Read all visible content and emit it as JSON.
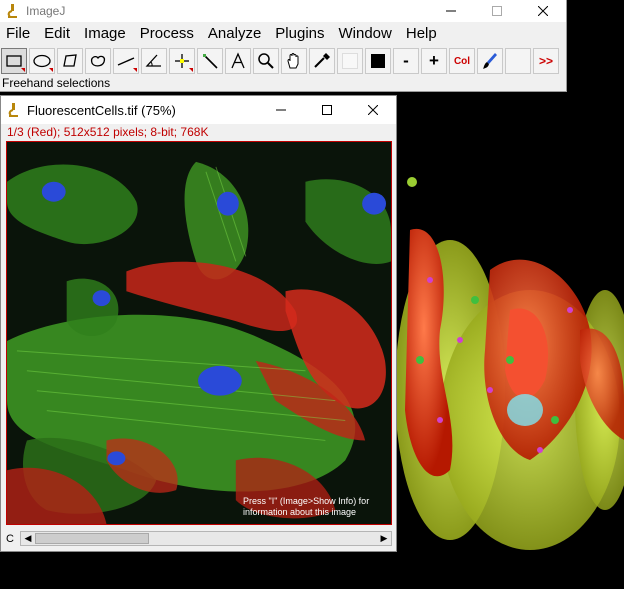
{
  "main_window": {
    "title": "ImageJ",
    "menu": [
      "File",
      "Edit",
      "Image",
      "Process",
      "Analyze",
      "Plugins",
      "Window",
      "Help"
    ],
    "toolbar": {
      "tools": [
        {
          "name": "rectangle-tool-icon",
          "active": true
        },
        {
          "name": "oval-tool-icon"
        },
        {
          "name": "polygon-tool-icon"
        },
        {
          "name": "freehand-tool-icon"
        },
        {
          "name": "line-tool-icon"
        },
        {
          "name": "angle-tool-icon"
        },
        {
          "name": "point-tool-icon"
        },
        {
          "name": "wand-tool-icon"
        },
        {
          "name": "text-tool-icon"
        },
        {
          "name": "magnifier-icon"
        },
        {
          "name": "hand-icon"
        },
        {
          "name": "color-picker-icon"
        }
      ],
      "minus_label": "-",
      "plus_label": "+",
      "col_label": "Col",
      "more_label": ">>"
    },
    "status": "Freehand selections"
  },
  "image_window": {
    "title": "FluorescentCells.tif (75%)",
    "info": "1/3 (Red); 512x512 pixels; 8-bit; 768K",
    "overlay_line1": "Press \"I\" (Image>Show Info) for",
    "overlay_line2": "information about this image",
    "channel_label": "C",
    "scroll_value": 1,
    "scroll_max": 3
  },
  "colors": {
    "accent_red": "#c00000",
    "foreground": "#000000",
    "background": "#f4f4f4"
  }
}
